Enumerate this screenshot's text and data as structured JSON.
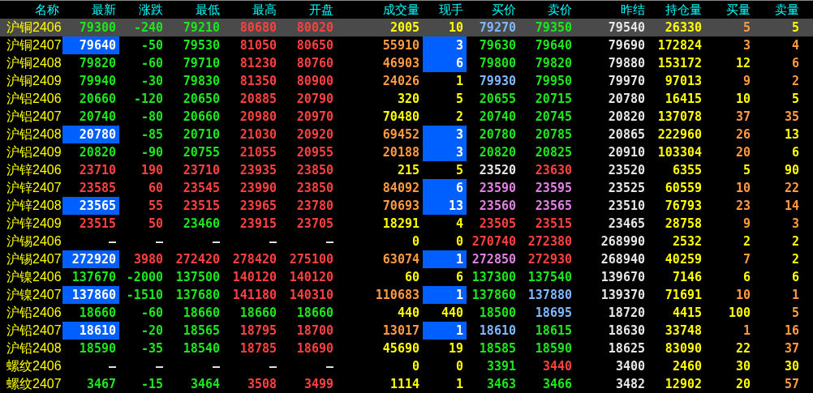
{
  "columns": [
    "名称",
    "最新",
    "涨跌",
    "最低",
    "最高",
    "开盘",
    "成交量",
    "现手",
    "买价",
    "卖价",
    "昨结",
    "持仓量",
    "买量",
    "卖量"
  ],
  "rows": [
    {
      "name": "沪铜2406",
      "selected": true,
      "latest_flash": false,
      "hand_flash": false,
      "cells": [
        {
          "text": "79300",
          "color": "#1ee61e"
        },
        {
          "text": "-240",
          "color": "#1ee61e"
        },
        {
          "text": "79210",
          "color": "#1ee61e"
        },
        {
          "text": "80680",
          "color": "#ff4040"
        },
        {
          "text": "80020",
          "color": "#ff4040"
        },
        {
          "text": "2005",
          "color": "#ffff00"
        },
        {
          "text": "10",
          "color": "#ffff00"
        },
        {
          "text": "79270",
          "color": "#80b8ff"
        },
        {
          "text": "79350",
          "color": "#1ee61e"
        },
        {
          "text": "79540",
          "color": "#e6e6e6"
        },
        {
          "text": "26330",
          "color": "#ffff00"
        },
        {
          "text": "5",
          "color": "#ff9a40"
        },
        {
          "text": "5",
          "color": "#ffff00"
        }
      ]
    },
    {
      "name": "沪铜2407",
      "selected": false,
      "latest_flash": true,
      "hand_flash": true,
      "cells": [
        {
          "text": "79640",
          "color": "#ffffff"
        },
        {
          "text": "-50",
          "color": "#1ee61e"
        },
        {
          "text": "79530",
          "color": "#1ee61e"
        },
        {
          "text": "81050",
          "color": "#ff4040"
        },
        {
          "text": "80650",
          "color": "#ff4040"
        },
        {
          "text": "55910",
          "color": "#ff9a40"
        },
        {
          "text": "3",
          "color": "#ffffff"
        },
        {
          "text": "79630",
          "color": "#1ee61e"
        },
        {
          "text": "79640",
          "color": "#1ee61e"
        },
        {
          "text": "79690",
          "color": "#e6e6e6"
        },
        {
          "text": "172824",
          "color": "#ffff00"
        },
        {
          "text": "3",
          "color": "#ff9a40"
        },
        {
          "text": "4",
          "color": "#ff9a40"
        }
      ]
    },
    {
      "name": "沪铜2408",
      "selected": false,
      "latest_flash": false,
      "hand_flash": true,
      "cells": [
        {
          "text": "79820",
          "color": "#1ee61e"
        },
        {
          "text": "-60",
          "color": "#1ee61e"
        },
        {
          "text": "79710",
          "color": "#1ee61e"
        },
        {
          "text": "81230",
          "color": "#ff4040"
        },
        {
          "text": "80760",
          "color": "#ff4040"
        },
        {
          "text": "46903",
          "color": "#ff9a40"
        },
        {
          "text": "6",
          "color": "#ffffff"
        },
        {
          "text": "79800",
          "color": "#1ee61e"
        },
        {
          "text": "79820",
          "color": "#1ee61e"
        },
        {
          "text": "79880",
          "color": "#e6e6e6"
        },
        {
          "text": "153172",
          "color": "#ffff00"
        },
        {
          "text": "12",
          "color": "#ffff00"
        },
        {
          "text": "6",
          "color": "#ff9a40"
        }
      ]
    },
    {
      "name": "沪铜2409",
      "selected": false,
      "latest_flash": false,
      "hand_flash": false,
      "cells": [
        {
          "text": "79940",
          "color": "#1ee61e"
        },
        {
          "text": "-30",
          "color": "#1ee61e"
        },
        {
          "text": "79830",
          "color": "#1ee61e"
        },
        {
          "text": "81350",
          "color": "#ff4040"
        },
        {
          "text": "80900",
          "color": "#ff4040"
        },
        {
          "text": "24026",
          "color": "#ff9a40"
        },
        {
          "text": "1",
          "color": "#ffff00"
        },
        {
          "text": "79930",
          "color": "#80b8ff"
        },
        {
          "text": "79950",
          "color": "#1ee61e"
        },
        {
          "text": "79970",
          "color": "#e6e6e6"
        },
        {
          "text": "97013",
          "color": "#ffff00"
        },
        {
          "text": "9",
          "color": "#ff9a40"
        },
        {
          "text": "2",
          "color": "#ff9a40"
        }
      ]
    },
    {
      "name": "沪铝2406",
      "selected": false,
      "latest_flash": false,
      "hand_flash": false,
      "cells": [
        {
          "text": "20660",
          "color": "#1ee61e"
        },
        {
          "text": "-120",
          "color": "#1ee61e"
        },
        {
          "text": "20650",
          "color": "#1ee61e"
        },
        {
          "text": "20885",
          "color": "#ff4040"
        },
        {
          "text": "20790",
          "color": "#ff4040"
        },
        {
          "text": "320",
          "color": "#ffff00"
        },
        {
          "text": "5",
          "color": "#ffff00"
        },
        {
          "text": "20655",
          "color": "#1ee61e"
        },
        {
          "text": "20715",
          "color": "#1ee61e"
        },
        {
          "text": "20780",
          "color": "#e6e6e6"
        },
        {
          "text": "16415",
          "color": "#ffff00"
        },
        {
          "text": "10",
          "color": "#ffff00"
        },
        {
          "text": "5",
          "color": "#ffff00"
        }
      ]
    },
    {
      "name": "沪铝2407",
      "selected": false,
      "latest_flash": false,
      "hand_flash": false,
      "cells": [
        {
          "text": "20740",
          "color": "#1ee61e"
        },
        {
          "text": "-80",
          "color": "#1ee61e"
        },
        {
          "text": "20660",
          "color": "#1ee61e"
        },
        {
          "text": "20980",
          "color": "#ff4040"
        },
        {
          "text": "20970",
          "color": "#ff4040"
        },
        {
          "text": "70480",
          "color": "#ffff00"
        },
        {
          "text": "2",
          "color": "#ffff00"
        },
        {
          "text": "20740",
          "color": "#1ee61e"
        },
        {
          "text": "20745",
          "color": "#1ee61e"
        },
        {
          "text": "20820",
          "color": "#e6e6e6"
        },
        {
          "text": "137078",
          "color": "#ffff00"
        },
        {
          "text": "37",
          "color": "#ff9a40"
        },
        {
          "text": "35",
          "color": "#ff9a40"
        }
      ]
    },
    {
      "name": "沪铝2408",
      "selected": false,
      "latest_flash": true,
      "hand_flash": true,
      "cells": [
        {
          "text": "20780",
          "color": "#ffffff"
        },
        {
          "text": "-85",
          "color": "#1ee61e"
        },
        {
          "text": "20710",
          "color": "#1ee61e"
        },
        {
          "text": "21030",
          "color": "#ff4040"
        },
        {
          "text": "20920",
          "color": "#ff4040"
        },
        {
          "text": "69452",
          "color": "#ff9a40"
        },
        {
          "text": "3",
          "color": "#ffffff"
        },
        {
          "text": "20780",
          "color": "#1ee61e"
        },
        {
          "text": "20785",
          "color": "#1ee61e"
        },
        {
          "text": "20865",
          "color": "#e6e6e6"
        },
        {
          "text": "222960",
          "color": "#ffff00"
        },
        {
          "text": "26",
          "color": "#ff9a40"
        },
        {
          "text": "13",
          "color": "#ffff00"
        }
      ]
    },
    {
      "name": "沪铝2409",
      "selected": false,
      "latest_flash": false,
      "hand_flash": true,
      "cells": [
        {
          "text": "20820",
          "color": "#1ee61e"
        },
        {
          "text": "-90",
          "color": "#1ee61e"
        },
        {
          "text": "20755",
          "color": "#1ee61e"
        },
        {
          "text": "21055",
          "color": "#ff4040"
        },
        {
          "text": "20955",
          "color": "#ff4040"
        },
        {
          "text": "20188",
          "color": "#ff9a40"
        },
        {
          "text": "3",
          "color": "#ffffff"
        },
        {
          "text": "20820",
          "color": "#1ee61e"
        },
        {
          "text": "20825",
          "color": "#1ee61e"
        },
        {
          "text": "20910",
          "color": "#e6e6e6"
        },
        {
          "text": "103304",
          "color": "#ffff00"
        },
        {
          "text": "20",
          "color": "#ff9a40"
        },
        {
          "text": "6",
          "color": "#ffff00"
        }
      ]
    },
    {
      "name": "沪锌2406",
      "selected": false,
      "latest_flash": false,
      "hand_flash": false,
      "cells": [
        {
          "text": "23710",
          "color": "#ff4040"
        },
        {
          "text": "190",
          "color": "#ff4040"
        },
        {
          "text": "23710",
          "color": "#ff4040"
        },
        {
          "text": "23935",
          "color": "#ff4040"
        },
        {
          "text": "23850",
          "color": "#ff4040"
        },
        {
          "text": "215",
          "color": "#ffff00"
        },
        {
          "text": "5",
          "color": "#ffff00"
        },
        {
          "text": "23520",
          "color": "#e6e6e6"
        },
        {
          "text": "23630",
          "color": "#ff4040"
        },
        {
          "text": "23520",
          "color": "#e6e6e6"
        },
        {
          "text": "6355",
          "color": "#ffff00"
        },
        {
          "text": "5",
          "color": "#ffff00"
        },
        {
          "text": "90",
          "color": "#ffff00"
        }
      ]
    },
    {
      "name": "沪锌2407",
      "selected": false,
      "latest_flash": false,
      "hand_flash": true,
      "cells": [
        {
          "text": "23585",
          "color": "#ff4040"
        },
        {
          "text": "60",
          "color": "#ff4040"
        },
        {
          "text": "23545",
          "color": "#ff4040"
        },
        {
          "text": "23990",
          "color": "#ff4040"
        },
        {
          "text": "23850",
          "color": "#ff4040"
        },
        {
          "text": "84092",
          "color": "#ff9a40"
        },
        {
          "text": "6",
          "color": "#ffffff"
        },
        {
          "text": "23590",
          "color": "#e080e0"
        },
        {
          "text": "23595",
          "color": "#e080e0"
        },
        {
          "text": "23525",
          "color": "#e6e6e6"
        },
        {
          "text": "60559",
          "color": "#ffff00"
        },
        {
          "text": "10",
          "color": "#ff9a40"
        },
        {
          "text": "22",
          "color": "#ff9a40"
        }
      ]
    },
    {
      "name": "沪锌2408",
      "selected": false,
      "latest_flash": true,
      "hand_flash": true,
      "cells": [
        {
          "text": "23565",
          "color": "#ffffff"
        },
        {
          "text": "55",
          "color": "#ff4040"
        },
        {
          "text": "23515",
          "color": "#ff4040"
        },
        {
          "text": "23965",
          "color": "#ff4040"
        },
        {
          "text": "23780",
          "color": "#ff4040"
        },
        {
          "text": "70693",
          "color": "#ff9a40"
        },
        {
          "text": "13",
          "color": "#ffffff"
        },
        {
          "text": "23560",
          "color": "#e080e0"
        },
        {
          "text": "23565",
          "color": "#e080e0"
        },
        {
          "text": "23510",
          "color": "#e6e6e6"
        },
        {
          "text": "76793",
          "color": "#ffff00"
        },
        {
          "text": "23",
          "color": "#ff9a40"
        },
        {
          "text": "14",
          "color": "#ff9a40"
        }
      ]
    },
    {
      "name": "沪锌2409",
      "selected": false,
      "latest_flash": false,
      "hand_flash": false,
      "cells": [
        {
          "text": "23515",
          "color": "#ff4040"
        },
        {
          "text": "50",
          "color": "#ff4040"
        },
        {
          "text": "23460",
          "color": "#1ee61e"
        },
        {
          "text": "23915",
          "color": "#ff4040"
        },
        {
          "text": "23705",
          "color": "#ff4040"
        },
        {
          "text": "18291",
          "color": "#ffff00"
        },
        {
          "text": "4",
          "color": "#ffff00"
        },
        {
          "text": "23505",
          "color": "#ff4040"
        },
        {
          "text": "23515",
          "color": "#ff4040"
        },
        {
          "text": "23465",
          "color": "#e6e6e6"
        },
        {
          "text": "28758",
          "color": "#ffff00"
        },
        {
          "text": "9",
          "color": "#ff9a40"
        },
        {
          "text": "3",
          "color": "#ff9a40"
        }
      ]
    },
    {
      "name": "沪锡2406",
      "selected": false,
      "latest_flash": false,
      "hand_flash": false,
      "cells": [
        {
          "text": "—",
          "color": "#e6e6e6"
        },
        {
          "text": "—",
          "color": "#e6e6e6"
        },
        {
          "text": "—",
          "color": "#e6e6e6"
        },
        {
          "text": "—",
          "color": "#e6e6e6"
        },
        {
          "text": "—",
          "color": "#e6e6e6"
        },
        {
          "text": "0",
          "color": "#ffff00"
        },
        {
          "text": "0",
          "color": "#ffff00"
        },
        {
          "text": "270740",
          "color": "#ff4040"
        },
        {
          "text": "272380",
          "color": "#ff4040"
        },
        {
          "text": "268990",
          "color": "#e6e6e6"
        },
        {
          "text": "2532",
          "color": "#ffff00"
        },
        {
          "text": "2",
          "color": "#ffff00"
        },
        {
          "text": "2",
          "color": "#ffff00"
        }
      ]
    },
    {
      "name": "沪锡2407",
      "selected": false,
      "latest_flash": true,
      "hand_flash": true,
      "cells": [
        {
          "text": "272920",
          "color": "#ffffff"
        },
        {
          "text": "3980",
          "color": "#ff4040"
        },
        {
          "text": "272420",
          "color": "#ff4040"
        },
        {
          "text": "278420",
          "color": "#ff4040"
        },
        {
          "text": "275100",
          "color": "#ff4040"
        },
        {
          "text": "63074",
          "color": "#ff9a40"
        },
        {
          "text": "1",
          "color": "#ffffff"
        },
        {
          "text": "272850",
          "color": "#e080e0"
        },
        {
          "text": "272930",
          "color": "#ff4040"
        },
        {
          "text": "268940",
          "color": "#e6e6e6"
        },
        {
          "text": "40259",
          "color": "#ffff00"
        },
        {
          "text": "7",
          "color": "#ff9a40"
        },
        {
          "text": "2",
          "color": "#ffff00"
        }
      ]
    },
    {
      "name": "沪镍2406",
      "selected": false,
      "latest_flash": false,
      "hand_flash": false,
      "cells": [
        {
          "text": "137670",
          "color": "#1ee61e"
        },
        {
          "text": "-2000",
          "color": "#1ee61e"
        },
        {
          "text": "137500",
          "color": "#1ee61e"
        },
        {
          "text": "140120",
          "color": "#ff4040"
        },
        {
          "text": "140120",
          "color": "#ff4040"
        },
        {
          "text": "60",
          "color": "#ffff00"
        },
        {
          "text": "6",
          "color": "#ffff00"
        },
        {
          "text": "137300",
          "color": "#1ee61e"
        },
        {
          "text": "137540",
          "color": "#1ee61e"
        },
        {
          "text": "139670",
          "color": "#e6e6e6"
        },
        {
          "text": "7146",
          "color": "#ffff00"
        },
        {
          "text": "6",
          "color": "#ffff00"
        },
        {
          "text": "6",
          "color": "#ffff00"
        }
      ]
    },
    {
      "name": "沪镍2407",
      "selected": false,
      "latest_flash": true,
      "hand_flash": true,
      "cells": [
        {
          "text": "137860",
          "color": "#ffffff"
        },
        {
          "text": "-1510",
          "color": "#1ee61e"
        },
        {
          "text": "137680",
          "color": "#1ee61e"
        },
        {
          "text": "141180",
          "color": "#ff4040"
        },
        {
          "text": "140310",
          "color": "#ff4040"
        },
        {
          "text": "110683",
          "color": "#ff9a40"
        },
        {
          "text": "1",
          "color": "#ffffff"
        },
        {
          "text": "137860",
          "color": "#1ee61e"
        },
        {
          "text": "137880",
          "color": "#80b8ff"
        },
        {
          "text": "139370",
          "color": "#e6e6e6"
        },
        {
          "text": "71691",
          "color": "#ffff00"
        },
        {
          "text": "10",
          "color": "#ff9a40"
        },
        {
          "text": "1",
          "color": "#ff9a40"
        }
      ]
    },
    {
      "name": "沪铅2406",
      "selected": false,
      "latest_flash": false,
      "hand_flash": false,
      "cells": [
        {
          "text": "18660",
          "color": "#1ee61e"
        },
        {
          "text": "-60",
          "color": "#1ee61e"
        },
        {
          "text": "18660",
          "color": "#1ee61e"
        },
        {
          "text": "18660",
          "color": "#1ee61e"
        },
        {
          "text": "18660",
          "color": "#1ee61e"
        },
        {
          "text": "440",
          "color": "#ffff00"
        },
        {
          "text": "440",
          "color": "#ffff00"
        },
        {
          "text": "18500",
          "color": "#1ee61e"
        },
        {
          "text": "18695",
          "color": "#80b8ff"
        },
        {
          "text": "18720",
          "color": "#e6e6e6"
        },
        {
          "text": "4415",
          "color": "#ffff00"
        },
        {
          "text": "100",
          "color": "#ffff00"
        },
        {
          "text": "5",
          "color": "#ff9a40"
        }
      ]
    },
    {
      "name": "沪铅2407",
      "selected": false,
      "latest_flash": true,
      "hand_flash": true,
      "cells": [
        {
          "text": "18610",
          "color": "#ffffff"
        },
        {
          "text": "-20",
          "color": "#1ee61e"
        },
        {
          "text": "18565",
          "color": "#1ee61e"
        },
        {
          "text": "18795",
          "color": "#ff4040"
        },
        {
          "text": "18700",
          "color": "#ff4040"
        },
        {
          "text": "13017",
          "color": "#ff9a40"
        },
        {
          "text": "1",
          "color": "#ffffff"
        },
        {
          "text": "18610",
          "color": "#80b8ff"
        },
        {
          "text": "18615",
          "color": "#1ee61e"
        },
        {
          "text": "18630",
          "color": "#e6e6e6"
        },
        {
          "text": "33748",
          "color": "#ffff00"
        },
        {
          "text": "1",
          "color": "#ff9a40"
        },
        {
          "text": "16",
          "color": "#ff9a40"
        }
      ]
    },
    {
      "name": "沪铅2408",
      "selected": false,
      "latest_flash": false,
      "hand_flash": false,
      "cells": [
        {
          "text": "18590",
          "color": "#1ee61e"
        },
        {
          "text": "-35",
          "color": "#1ee61e"
        },
        {
          "text": "18540",
          "color": "#1ee61e"
        },
        {
          "text": "18785",
          "color": "#ff4040"
        },
        {
          "text": "18690",
          "color": "#ff4040"
        },
        {
          "text": "45690",
          "color": "#ffff00"
        },
        {
          "text": "19",
          "color": "#ffff00"
        },
        {
          "text": "18585",
          "color": "#1ee61e"
        },
        {
          "text": "18590",
          "color": "#1ee61e"
        },
        {
          "text": "18625",
          "color": "#e6e6e6"
        },
        {
          "text": "83090",
          "color": "#ffff00"
        },
        {
          "text": "22",
          "color": "#ffff00"
        },
        {
          "text": "37",
          "color": "#ff9a40"
        }
      ]
    },
    {
      "name": "螺纹2406",
      "selected": false,
      "latest_flash": false,
      "hand_flash": false,
      "cells": [
        {
          "text": "—",
          "color": "#e6e6e6"
        },
        {
          "text": "—",
          "color": "#e6e6e6"
        },
        {
          "text": "—",
          "color": "#e6e6e6"
        },
        {
          "text": "—",
          "color": "#e6e6e6"
        },
        {
          "text": "—",
          "color": "#e6e6e6"
        },
        {
          "text": "0",
          "color": "#ffff00"
        },
        {
          "text": "0",
          "color": "#ffff00"
        },
        {
          "text": "3391",
          "color": "#1ee61e"
        },
        {
          "text": "3440",
          "color": "#ff4040"
        },
        {
          "text": "3400",
          "color": "#e6e6e6"
        },
        {
          "text": "2460",
          "color": "#ffff00"
        },
        {
          "text": "30",
          "color": "#ffff00"
        },
        {
          "text": "30",
          "color": "#ffff00"
        }
      ]
    },
    {
      "name": "螺纹2407",
      "selected": false,
      "latest_flash": false,
      "hand_flash": false,
      "cells": [
        {
          "text": "3467",
          "color": "#1ee61e"
        },
        {
          "text": "-15",
          "color": "#1ee61e"
        },
        {
          "text": "3464",
          "color": "#1ee61e"
        },
        {
          "text": "3508",
          "color": "#ff4040"
        },
        {
          "text": "3499",
          "color": "#ff4040"
        },
        {
          "text": "1114",
          "color": "#ffff00"
        },
        {
          "text": "1",
          "color": "#ffff00"
        },
        {
          "text": "3463",
          "color": "#1ee61e"
        },
        {
          "text": "3466",
          "color": "#1ee61e"
        },
        {
          "text": "3482",
          "color": "#e6e6e6"
        },
        {
          "text": "12902",
          "color": "#ffff00"
        },
        {
          "text": "20",
          "color": "#ffff00"
        },
        {
          "text": "57",
          "color": "#ff9a40"
        }
      ]
    }
  ]
}
